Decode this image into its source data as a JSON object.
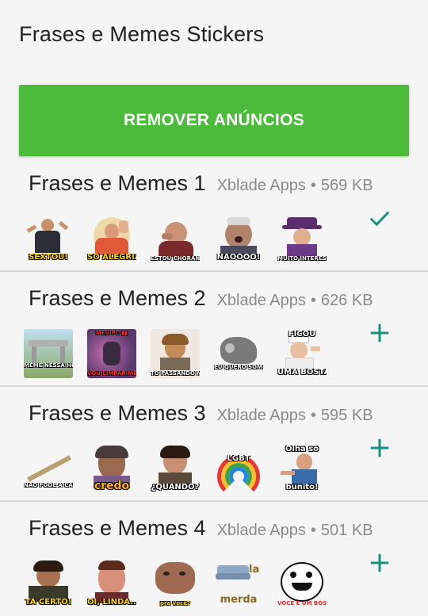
{
  "app": {
    "title": "Frases e Memes Stickers"
  },
  "remove_ads": {
    "label": "REMOVER ANÚNCIOS"
  },
  "colors": {
    "accent_green": "#4cba3a",
    "action_teal": "#178f80"
  },
  "packs": [
    {
      "name": "Frases e Memes 1",
      "publisher": "Xblade Apps",
      "separator": "•",
      "size": "569 KB",
      "action": "check-icon",
      "stickers": [
        "SEXTOU!",
        "SÓ ALEGRIA",
        "ESTOU CHORANDO",
        "NÃOOOO!",
        "MUITO INTERESSANTE"
      ]
    },
    {
      "name": "Frases e Memes 2",
      "publisher": "Xblade Apps",
      "separator": "•",
      "size": "626 KB",
      "action": "plus-icon",
      "stickers": [
        "MEME NESSA HORA",
        "VOU LIMPAR MEU PC",
        "TO PASSANDO MAL",
        "EU QUERO SOMENTE PAZ",
        "UMA BOSTA"
      ]
    },
    {
      "name": "Frases e Memes 3",
      "publisher": "Xblade Apps",
      "separator": "•",
      "size": "595 KB",
      "action": "plus-icon",
      "stickers": [
        "NÃO FODE A CAB",
        "credo",
        "¿QUANDO?",
        "LGBT",
        "bunito!"
      ]
    },
    {
      "name": "Frases e Memes 4",
      "publisher": "Xblade Apps",
      "separator": "•",
      "size": "501 KB",
      "action": "plus-icon",
      "stickers": [
        "TA CERTO!",
        "OI, LINDA...",
        "pra você?",
        "merda",
        "VOCÊ É UM BOSTA"
      ]
    }
  ]
}
